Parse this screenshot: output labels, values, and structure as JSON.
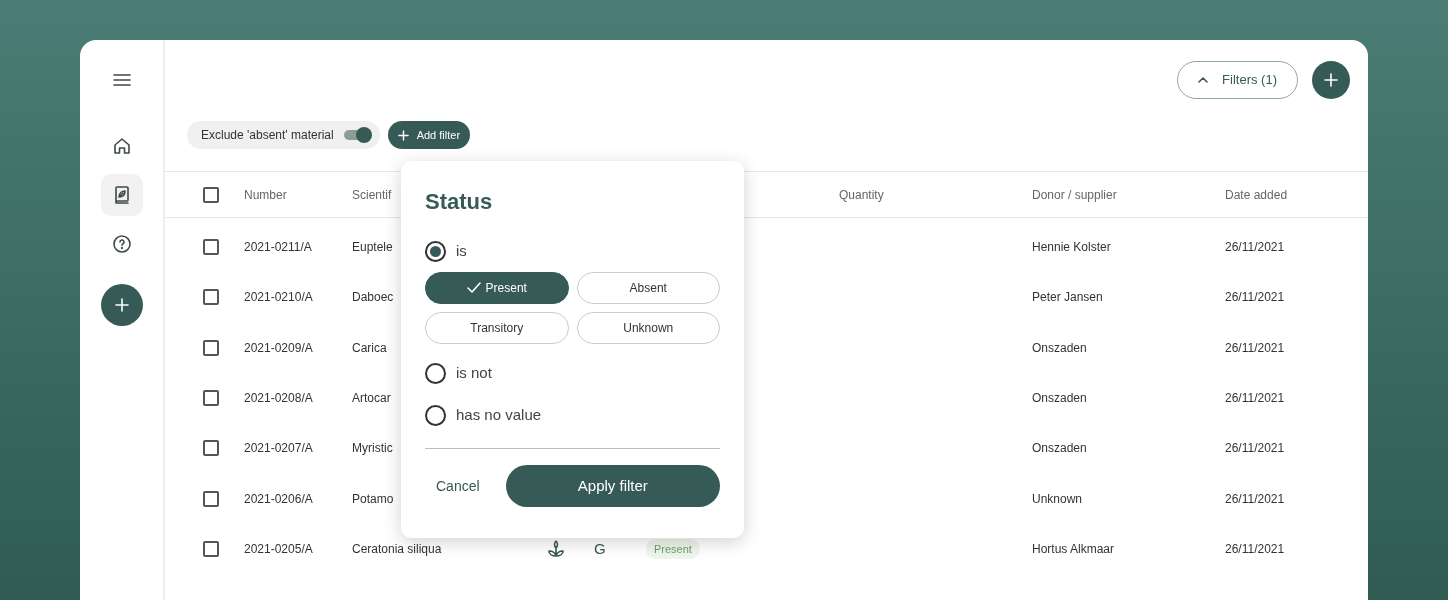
{
  "sidebar": {
    "items": [
      {
        "kind": "home",
        "selected": false
      },
      {
        "kind": "catalog",
        "selected": true
      },
      {
        "kind": "help",
        "selected": false
      }
    ]
  },
  "toolbar": {
    "filters_button": {
      "label": "Filters (1)",
      "expanded": true
    }
  },
  "filter_chips": {
    "toggle": {
      "label": "Exclude 'absent' material",
      "on": true
    },
    "add_filter": "Add filter"
  },
  "table": {
    "select_all": {
      "checked": false
    },
    "columns": [
      "Number",
      "Scientif",
      "",
      "",
      "",
      "Quantity",
      "Donor / supplier",
      "Date added"
    ],
    "rows": [
      {
        "checked": false,
        "number": "2021-0211/A",
        "scientific_name": "Euptele",
        "donor": "Hennie Kolster",
        "date_added": "26/11/2021"
      },
      {
        "checked": false,
        "number": "2021-0210/A",
        "scientific_name": "Daboec",
        "donor": "Peter Jansen",
        "date_added": "26/11/2021"
      },
      {
        "checked": false,
        "number": "2021-0209/A",
        "scientific_name": "Carica",
        "donor": "Onszaden",
        "date_added": "26/11/2021"
      },
      {
        "checked": false,
        "number": "2021-0208/A",
        "scientific_name": "Artocar",
        "donor": "Onszaden",
        "date_added": "26/11/2021"
      },
      {
        "checked": false,
        "number": "2021-0207/A",
        "scientific_name": "Myristic",
        "donor": "Onszaden",
        "date_added": "26/11/2021"
      },
      {
        "checked": false,
        "number": "2021-0206/A",
        "scientific_name": "Potamo",
        "donor": "Unknown",
        "date_added": "26/11/2021"
      },
      {
        "checked": false,
        "number": "2021-0205/A",
        "scientific_name": "Ceratonia siliqua",
        "plant": true,
        "type_letter": "G",
        "status": "Present",
        "donor": "Hortus Alkmaar",
        "date_added": "26/11/2021"
      }
    ]
  },
  "status_popup": {
    "title": "Status",
    "conditions": [
      {
        "label": "is",
        "selected": true
      },
      {
        "label": "is not",
        "selected": false
      },
      {
        "label": "has no value",
        "selected": false
      }
    ],
    "values": [
      {
        "label": "Present",
        "selected": true
      },
      {
        "label": "Absent",
        "selected": false
      },
      {
        "label": "Transitory",
        "selected": false
      },
      {
        "label": "Unknown",
        "selected": false
      }
    ],
    "cancel": "Cancel",
    "apply": "Apply filter"
  }
}
